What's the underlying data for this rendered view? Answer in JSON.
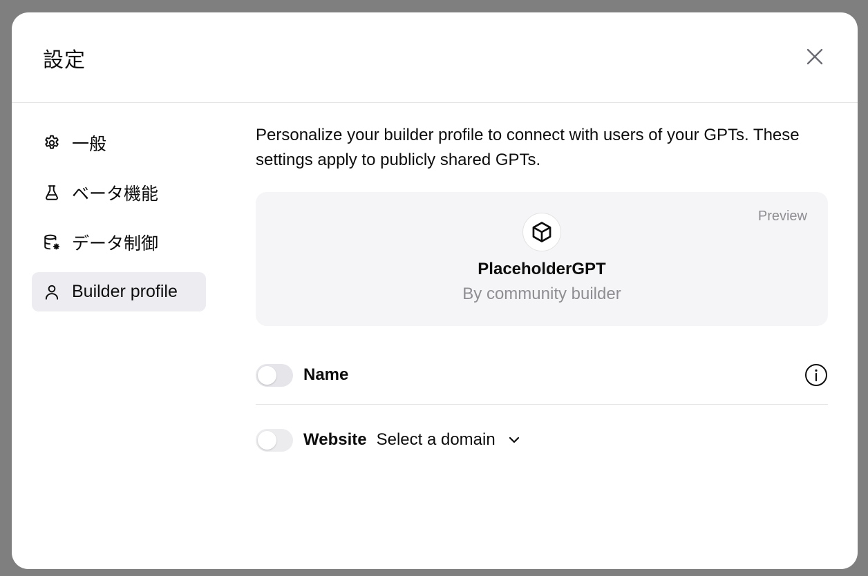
{
  "dialog": {
    "title": "設定"
  },
  "sidebar": {
    "items": [
      {
        "label": "一般",
        "icon": "gear-icon",
        "active": false
      },
      {
        "label": "ベータ機能",
        "icon": "flask-icon",
        "active": false
      },
      {
        "label": "データ制御",
        "icon": "database-settings-icon",
        "active": false
      },
      {
        "label": "Builder profile",
        "icon": "user-icon",
        "active": true
      }
    ]
  },
  "builder_profile": {
    "description": "Personalize your builder profile to connect with users of your GPTs. These settings apply to publicly shared GPTs.",
    "preview": {
      "label": "Preview",
      "gpt_name": "PlaceholderGPT",
      "byline": "By community builder",
      "avatar_icon": "cube-icon"
    },
    "name_setting": {
      "label": "Name",
      "enabled": false
    },
    "website_setting": {
      "label": "Website",
      "enabled": false,
      "domain_placeholder": "Select a domain"
    }
  }
}
